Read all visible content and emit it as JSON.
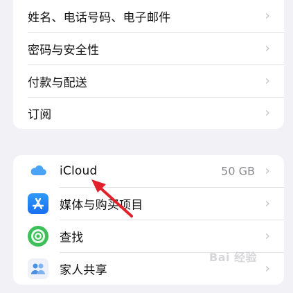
{
  "group1": {
    "items": [
      {
        "label": "姓名、电话号码、电子邮件"
      },
      {
        "label": "密码与安全性"
      },
      {
        "label": "付款与配送"
      },
      {
        "label": "订阅"
      }
    ]
  },
  "group2": {
    "items": [
      {
        "label": "iCloud",
        "value": "50 GB",
        "icon": "icloud-icon"
      },
      {
        "label": "媒体与购买项目",
        "icon": "app-store-icon"
      },
      {
        "label": "查找",
        "icon": "find-my-icon"
      },
      {
        "label": "家人共享",
        "icon": "family-sharing-icon"
      }
    ]
  },
  "watermark": "Bai 经验",
  "colors": {
    "background": "#f2f2f6",
    "annotation_arrow": "#e0202a"
  }
}
